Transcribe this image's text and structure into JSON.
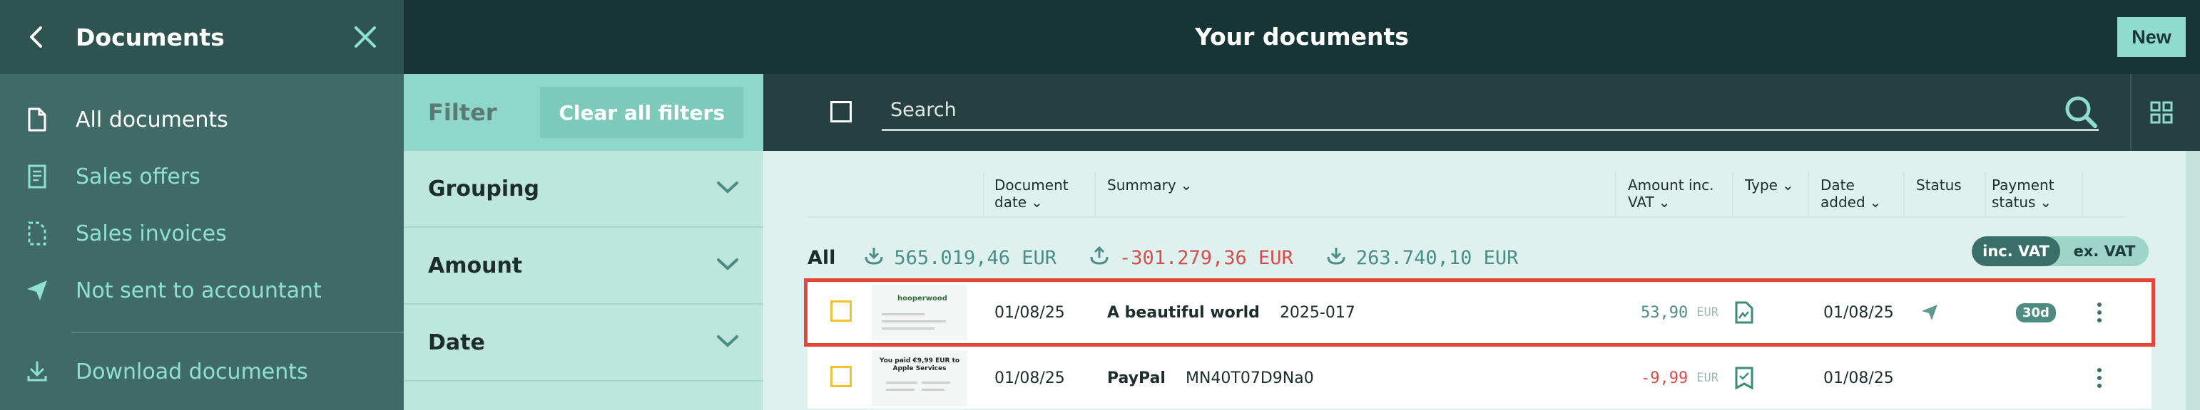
{
  "sidebar": {
    "title": "Documents",
    "items": [
      {
        "label": "All documents",
        "icon": "document-icon"
      },
      {
        "label": "Sales offers",
        "icon": "offer-icon"
      },
      {
        "label": "Sales invoices",
        "icon": "invoice-icon"
      },
      {
        "label": "Not sent to accountant",
        "icon": "send-icon"
      },
      {
        "label": "Download documents",
        "icon": "download-icon"
      }
    ]
  },
  "topbar": {
    "title": "Your documents",
    "new_label": "New"
  },
  "filter": {
    "title": "Filter",
    "clear_label": "Clear all filters",
    "sections": [
      "Grouping",
      "Amount",
      "Date"
    ]
  },
  "search": {
    "placeholder": "Search"
  },
  "columns": {
    "doc_date": "Document date",
    "summary": "Summary",
    "amount": "Amount inc. VAT",
    "type": "Type",
    "date_added": "Date added",
    "status": "Status",
    "payment": "Payment status"
  },
  "totals": {
    "label": "All",
    "income": "565.019,46 EUR",
    "expense": "-301.279,36 EUR",
    "balance": "263.740,10 EUR"
  },
  "vat_toggle": {
    "inc": "inc. VAT",
    "ex": "ex. VAT"
  },
  "rows": [
    {
      "thumb_text": "hooperwood",
      "doc_date": "01/08/25",
      "name": "A beautiful world",
      "ref": "2025-017",
      "amount": "53,90",
      "currency": "EUR",
      "date_added": "01/08/25",
      "payment_badge": "30d"
    },
    {
      "thumb_text": "You paid €9,99 EUR to Apple Services",
      "doc_date": "01/08/25",
      "name": "PayPal",
      "ref": "MN40T07D9Na0",
      "amount": "-9,99",
      "currency": "EUR",
      "date_added": "01/08/25"
    }
  ],
  "colors": {
    "sidebar_bg": "#406a66",
    "topbar_bg": "#173534",
    "accent": "#8fdccb",
    "negative": "#d64d4d",
    "highlight": "#e2453a"
  }
}
